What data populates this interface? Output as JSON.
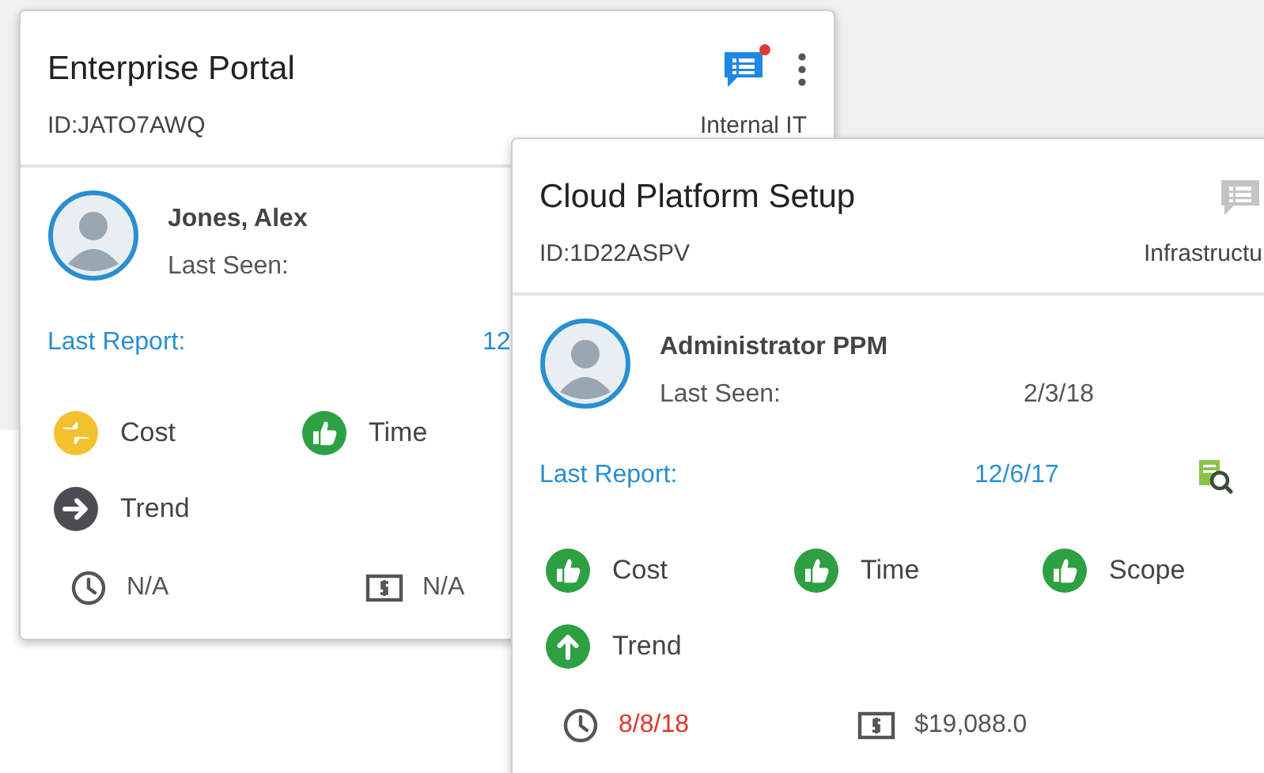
{
  "cards": [
    {
      "title": "Enterprise Portal",
      "id": "ID:JATO7AWQ",
      "department": "Internal IT",
      "chat": {
        "highlighted": true,
        "notification": true
      },
      "person": {
        "name": "Jones, Alex",
        "last_seen_label": "Last Seen:"
      },
      "report": {
        "label": "Last Report:",
        "date": "12",
        "viewable": false
      },
      "indicators": [
        {
          "label": "Cost",
          "kind": "mixed",
          "color": "#f2c12e"
        },
        {
          "label": "Time",
          "kind": "approve",
          "color": "#2ea043"
        },
        {
          "label": "Trend",
          "kind": "steady",
          "color": "#4a4d52"
        }
      ],
      "footer": {
        "due_date": "N/A",
        "overdue": false,
        "budget": "N/A"
      }
    },
    {
      "title": "Cloud Platform Setup",
      "id": "ID:1D22ASPV",
      "department": "Infrastructu",
      "chat": {
        "highlighted": false,
        "notification": false
      },
      "person": {
        "name": "Administrator PPM",
        "last_seen_label": "Last Seen:",
        "last_seen": "2/3/18"
      },
      "report": {
        "label": "Last Report:",
        "date": "12/6/17",
        "viewable": true
      },
      "indicators": [
        {
          "label": "Cost",
          "kind": "approve",
          "color": "#2ea043"
        },
        {
          "label": "Time",
          "kind": "approve",
          "color": "#2ea043"
        },
        {
          "label": "Scope",
          "kind": "approve",
          "color": "#2ea043"
        },
        {
          "label": "Trend",
          "kind": "rising",
          "color": "#2ea043"
        }
      ],
      "footer": {
        "due_date": "8/8/18",
        "overdue": true,
        "budget": "$19,088.0"
      }
    }
  ]
}
